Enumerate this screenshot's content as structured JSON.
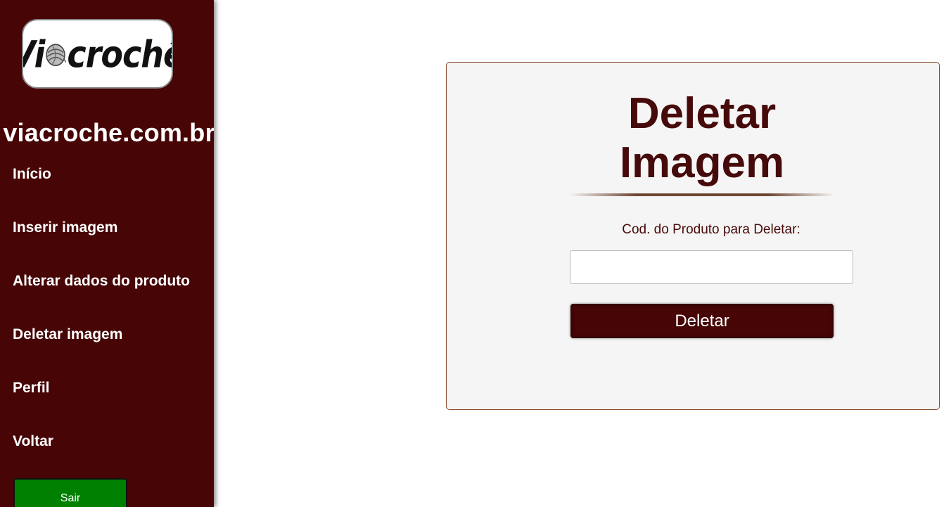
{
  "sidebar": {
    "logo": {
      "text_left": "Vi",
      "text_right": "crochê",
      "ball_icon": "yarn-ball-icon"
    },
    "site_name": "viacroche.com.br",
    "nav_items": [
      {
        "label": "Início"
      },
      {
        "label": "Inserir imagem"
      },
      {
        "label": "Alterar dados do produto"
      },
      {
        "label": "Deletar imagem"
      },
      {
        "label": "Perfil"
      },
      {
        "label": "Voltar"
      }
    ],
    "logout_label": "Sair"
  },
  "form": {
    "title_line1": "Deletar",
    "title_line2": "Imagem",
    "field_label": "Cod. do Produto para Deletar:",
    "code_value": "",
    "submit_label": "Deletar"
  },
  "colors": {
    "sidebar_bg": "#470505",
    "title_color": "#470a0a",
    "logout_button": "#008000",
    "card_bg": "#f5f5f5"
  }
}
